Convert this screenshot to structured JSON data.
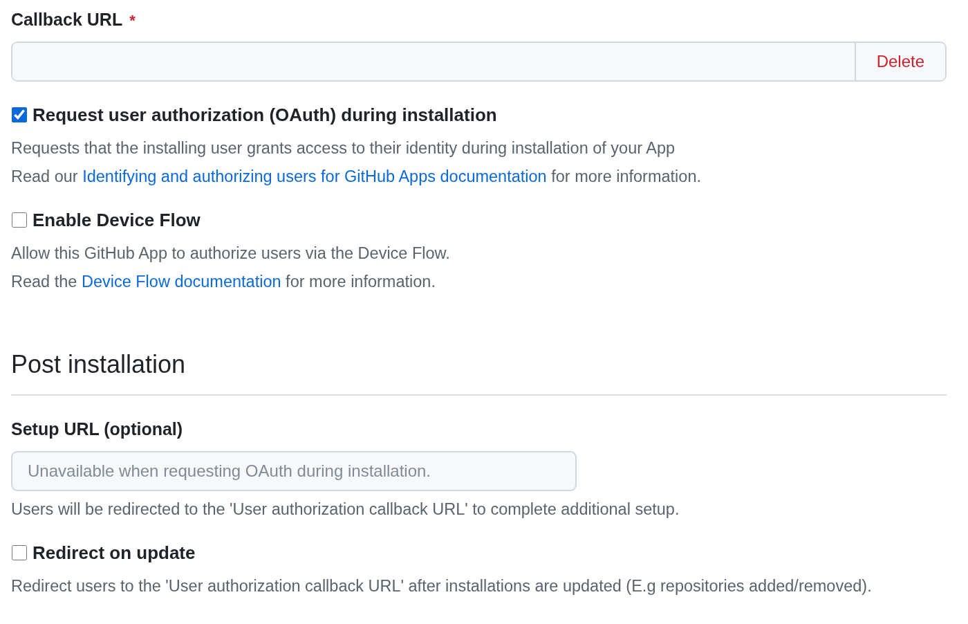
{
  "callback_url": {
    "label": "Callback URL",
    "required_mark": "*",
    "delete_button": "Delete"
  },
  "options": [
    {
      "label": "Request user authorization (OAuth) during installation",
      "checked": true,
      "lines": [
        {
          "kind": "text",
          "text": "Requests that the installing user grants access to their identity during installation of your App"
        },
        {
          "kind": "link",
          "before": "Read our ",
          "link": "Identifying and authorizing users for GitHub Apps documentation",
          "after": " for more information."
        }
      ]
    },
    {
      "label": "Enable Device Flow",
      "checked": false,
      "lines": [
        {
          "kind": "text",
          "text": "Allow this GitHub App to authorize users via the Device Flow."
        },
        {
          "kind": "link",
          "before": "Read the ",
          "link": "Device Flow documentation",
          "after": " for more information."
        }
      ]
    }
  ],
  "post_installation": {
    "heading": "Post installation",
    "setup_url": {
      "label": "Setup URL (optional)",
      "placeholder": "Unavailable when requesting OAuth during installation.",
      "disabled": true,
      "help": "Users will be redirected to the 'User authorization callback URL' to complete additional setup."
    },
    "redirect": {
      "label": "Redirect on update",
      "checked": false,
      "description": "Redirect users to the 'User authorization callback URL' after installations are updated (E.g repositories added/removed)."
    }
  }
}
